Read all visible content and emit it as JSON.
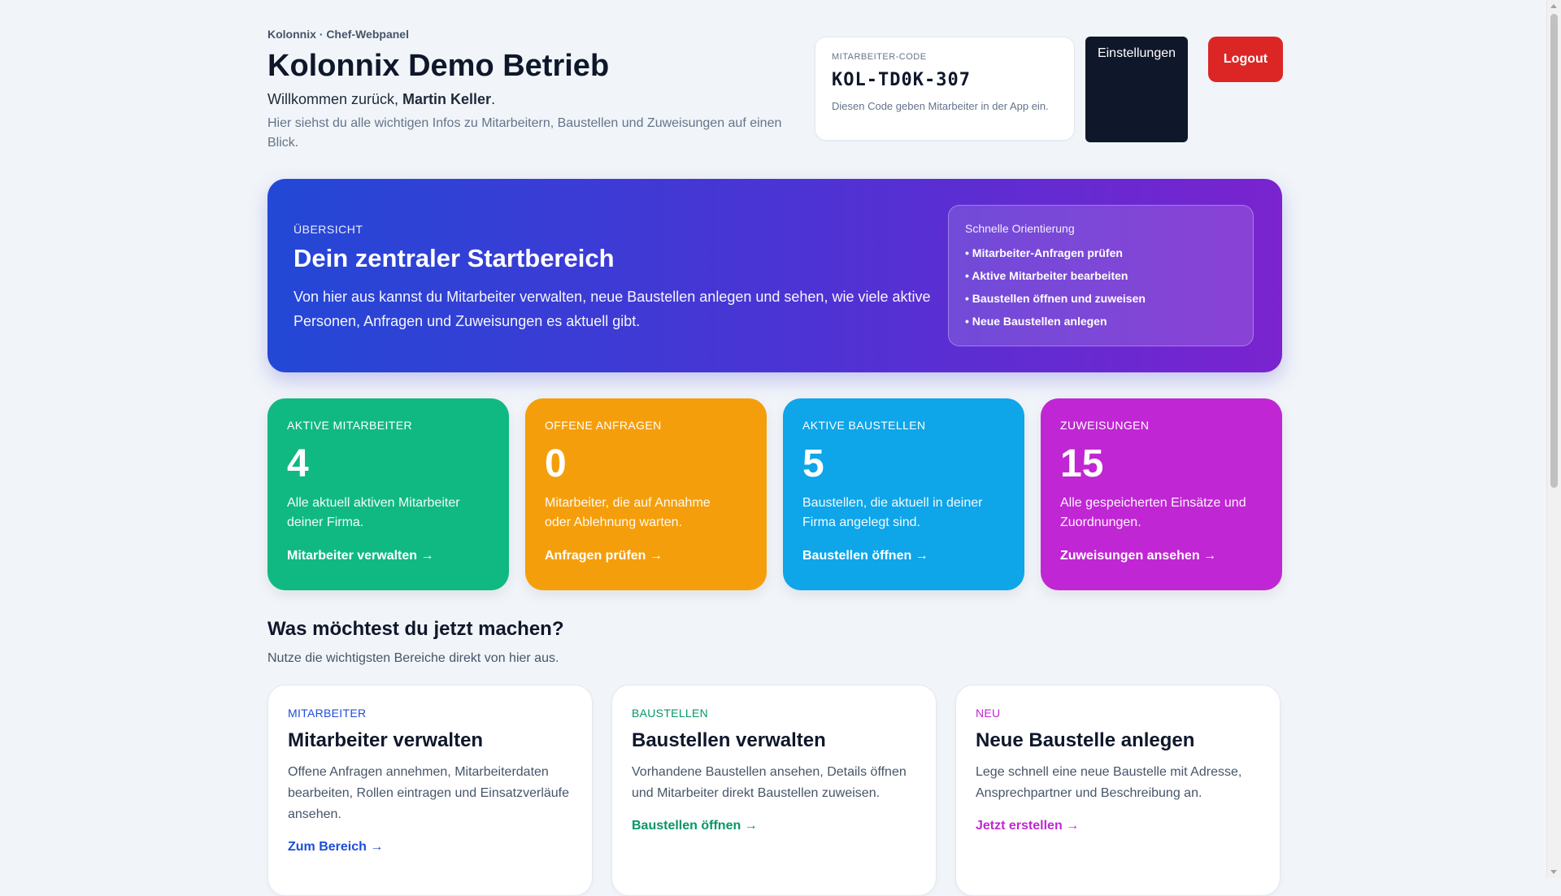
{
  "header": {
    "eyebrow": "Kolonnix · Chef-Webpanel",
    "title": "Kolonnix Demo Betrieb",
    "welcome_prefix": "Willkommen zurück, ",
    "user_name": "Martin Keller",
    "welcome_suffix": ".",
    "intro": "Hier siehst du alle wichtigen Infos zu Mitarbeitern, Baustellen und Zuweisungen auf einen Blick.",
    "settings_label": "Einstellungen",
    "logout_label": "Logout"
  },
  "employee_code": {
    "label": "MITARBEITER-CODE",
    "value": "KOL-TD0K-307",
    "hint": "Diesen Code geben Mitarbeiter in der App ein."
  },
  "hero": {
    "eyebrow": "ÜBERSICHT",
    "title": "Dein zentraler Startbereich",
    "text": "Von hier aus kannst du Mitarbeiter verwalten, neue Baustellen anlegen und sehen, wie viele aktive Personen, Anfragen und Zuweisungen es aktuell gibt.",
    "quick_title": "Schnelle Orientierung",
    "quick_items": [
      "• Mitarbeiter-Anfragen prüfen",
      "• Aktive Mitarbeiter bearbeiten",
      "• Baustellen öffnen und zuweisen",
      "• Neue Baustellen anlegen"
    ]
  },
  "stats": [
    {
      "label": "AKTIVE MITARBEITER",
      "value": "4",
      "desc": "Alle aktuell aktiven Mitarbeiter deiner Firma.",
      "link": "Mitarbeiter verwalten →",
      "color": "#10b981"
    },
    {
      "label": "OFFENE ANFRAGEN",
      "value": "0",
      "desc": "Mitarbeiter, die auf Annahme oder Ablehnung warten.",
      "link": "Anfragen prüfen →",
      "color": "#f59e0b"
    },
    {
      "label": "AKTIVE BAUSTELLEN",
      "value": "5",
      "desc": "Baustellen, die aktuell in deiner Firma angelegt sind.",
      "link": "Baustellen öffnen →",
      "color": "#0ea5e9"
    },
    {
      "label": "ZUWEISUNGEN",
      "value": "15",
      "desc": "Alle gespeicherten Einsätze und Zuordnungen.",
      "link": "Zuweisungen ansehen →",
      "color": "#c026d3"
    }
  ],
  "section": {
    "title": "Was möchtest du jetzt machen?",
    "subtitle": "Nutze die wichtigsten Bereiche direkt von hier aus."
  },
  "actions": [
    {
      "tag": "MITARBEITER",
      "title": "Mitarbeiter verwalten",
      "desc": "Offene Anfragen annehmen, Mitarbeiterdaten bearbeiten, Rollen eintragen und Einsatzverläufe ansehen.",
      "link": "Zum Bereich →",
      "color": "#1d4ed8"
    },
    {
      "tag": "BAUSTELLEN",
      "title": "Baustellen verwalten",
      "desc": "Vorhandene Baustellen ansehen, Details öffnen und Mitarbeiter direkt Baustellen zuweisen.",
      "link": "Baustellen öffnen →",
      "color": "#059669"
    },
    {
      "tag": "NEU",
      "title": "Neue Baustelle anlegen",
      "desc": "Lege schnell eine neue Baustelle mit Adresse, Ansprechpartner und Beschreibung an.",
      "link": "Jetzt erstellen →",
      "color": "#c026d3"
    }
  ]
}
